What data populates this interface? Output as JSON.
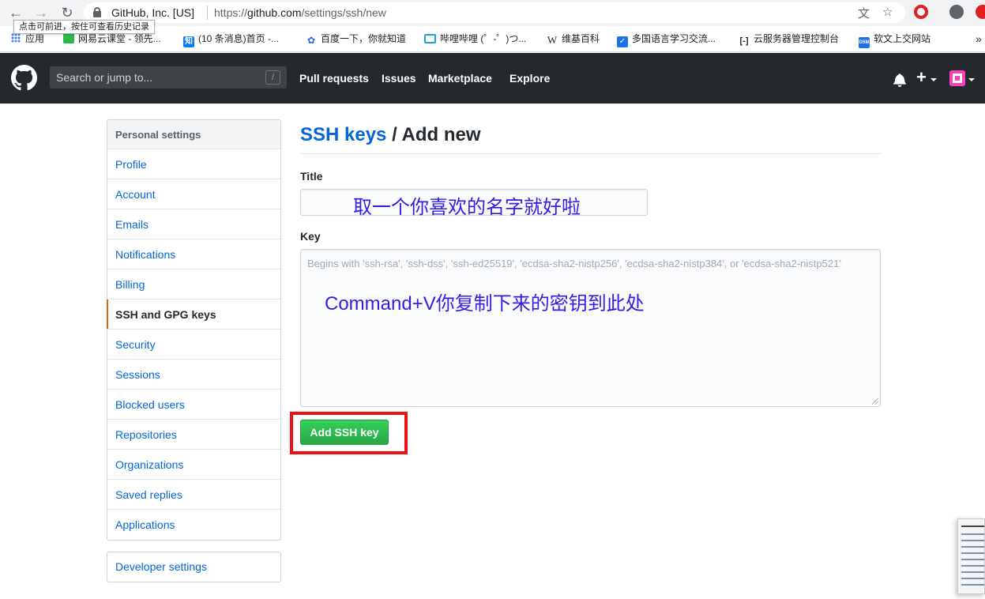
{
  "browser": {
    "org": "GitHub, Inc. [US]",
    "url_prefix": "https://",
    "url_host": "github.com",
    "url_path": "/settings/ssh/new",
    "tooltip": "点击可前进，按住可查看历史记录",
    "bookmarks": [
      {
        "label": "应用",
        "icon": "apps-grid-icon"
      },
      {
        "label": "网易云课堂 - 领先...",
        "icon": "netease-icon",
        "color": "#2db84d"
      },
      {
        "label": "(10 条消息)首页 -...",
        "icon": "zhihu-icon",
        "color": "#0a7bf3"
      },
      {
        "label": "百度一下，你就知道",
        "icon": "baidu-paw-icon",
        "color": "#2d62e8"
      },
      {
        "label": "哔哩哔哩 (゜-゜)つ...",
        "icon": "bilibili-icon",
        "color": "#19a4dd"
      },
      {
        "label": "维基百科",
        "icon": "wikipedia-icon"
      },
      {
        "label": "多国语言学习交流...",
        "icon": "check-shield-icon",
        "color": "#1a73e8"
      },
      {
        "label": "云服务器管理控制台",
        "icon": "aliyun-icon"
      },
      {
        "label": "软文上交网站",
        "icon": "dsm-icon",
        "color": "#1a73e8"
      }
    ],
    "more_bookmarks": "»"
  },
  "header": {
    "search_placeholder": "Search or jump to...",
    "slash": "/",
    "nav": [
      "Pull requests",
      "Issues",
      "Marketplace",
      "Explore"
    ],
    "plus": "+"
  },
  "sidebar": {
    "header": "Personal settings",
    "items": [
      {
        "label": "Profile"
      },
      {
        "label": "Account"
      },
      {
        "label": "Emails"
      },
      {
        "label": "Notifications"
      },
      {
        "label": "Billing"
      },
      {
        "label": "SSH and GPG keys",
        "selected": true
      },
      {
        "label": "Security"
      },
      {
        "label": "Sessions"
      },
      {
        "label": "Blocked users"
      },
      {
        "label": "Repositories"
      },
      {
        "label": "Organizations"
      },
      {
        "label": "Saved replies"
      },
      {
        "label": "Applications"
      }
    ],
    "developer_settings": "Developer settings"
  },
  "main": {
    "breadcrumb_link": "SSH keys",
    "breadcrumb_rest": " / Add new",
    "title_label": "Title",
    "title_value": "取一个你喜欢的名字就好啦",
    "key_label": "Key",
    "key_placeholder": "Begins with 'ssh-rsa', 'ssh-dss', 'ssh-ed25519', 'ecdsa-sha2-nistp256', 'ecdsa-sha2-nistp384', or 'ecdsa-sha2-nistp521'",
    "key_annotation": "Command+V你复制下来的密钥到此处",
    "submit_label": "Add SSH key"
  },
  "colors": {
    "header_bg": "#24292e",
    "link": "#0366d6",
    "annotation": "#2f1ee6",
    "highlight": "#ee1111",
    "button": "#28a745"
  }
}
